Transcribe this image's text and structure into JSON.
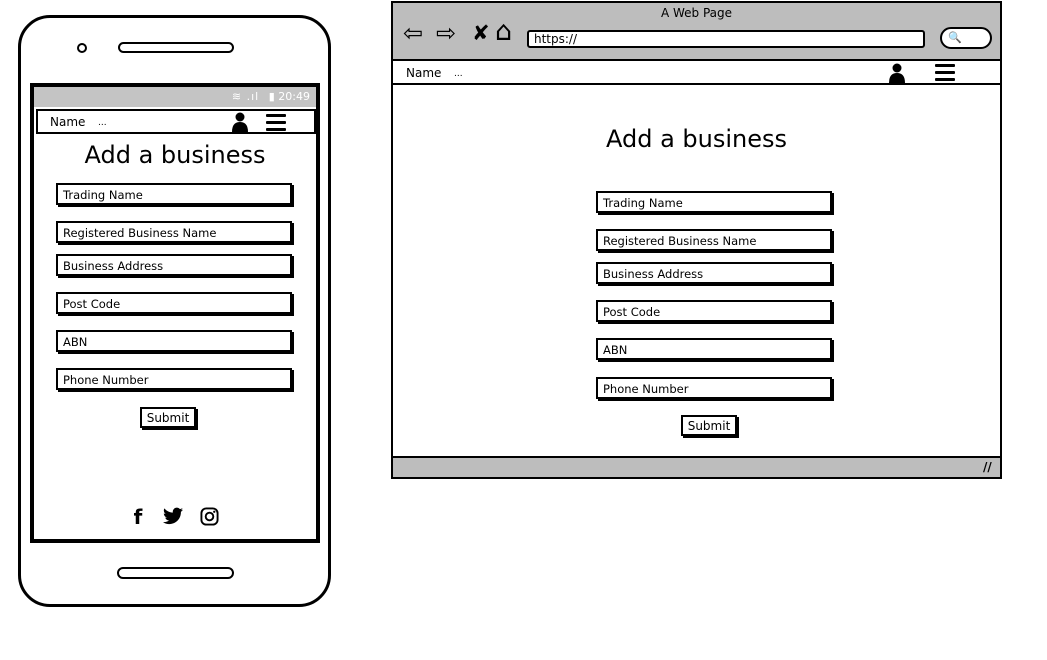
{
  "phone": {
    "status": {
      "signal": "≋ .ıl",
      "battery": "▮",
      "time": "20:49"
    },
    "nav": {
      "name": "Name",
      "dots": "...",
      "user_icon": "user-icon",
      "menu_icon": "hamburger-menu-icon"
    },
    "title": "Add a business",
    "fields": [
      "Trading Name",
      "Registered Business Name",
      "Business Address",
      "Post Code",
      "ABN",
      "Phone Number"
    ],
    "submit_label": "Submit",
    "social": {
      "facebook": "f",
      "twitter": "🐦",
      "instagram": "◎"
    }
  },
  "browser": {
    "title": "A Web Page",
    "url": "https://",
    "nav": {
      "name": "Name",
      "dots": "...",
      "user_icon": "user-icon",
      "menu_icon": "hamburger-menu-icon"
    },
    "title_text": "Add a business",
    "fields": [
      "Trading Name",
      "Registered Business Name",
      "Business Address",
      "Post Code",
      "ABN",
      "Phone Number"
    ],
    "submit_label": "Submit",
    "back_glyph": "⇦",
    "forward_glyph": "⇨",
    "close_glyph": "✘",
    "home_glyph": "⌂",
    "search_glyph": "🔍",
    "resize_glyph": "//"
  }
}
